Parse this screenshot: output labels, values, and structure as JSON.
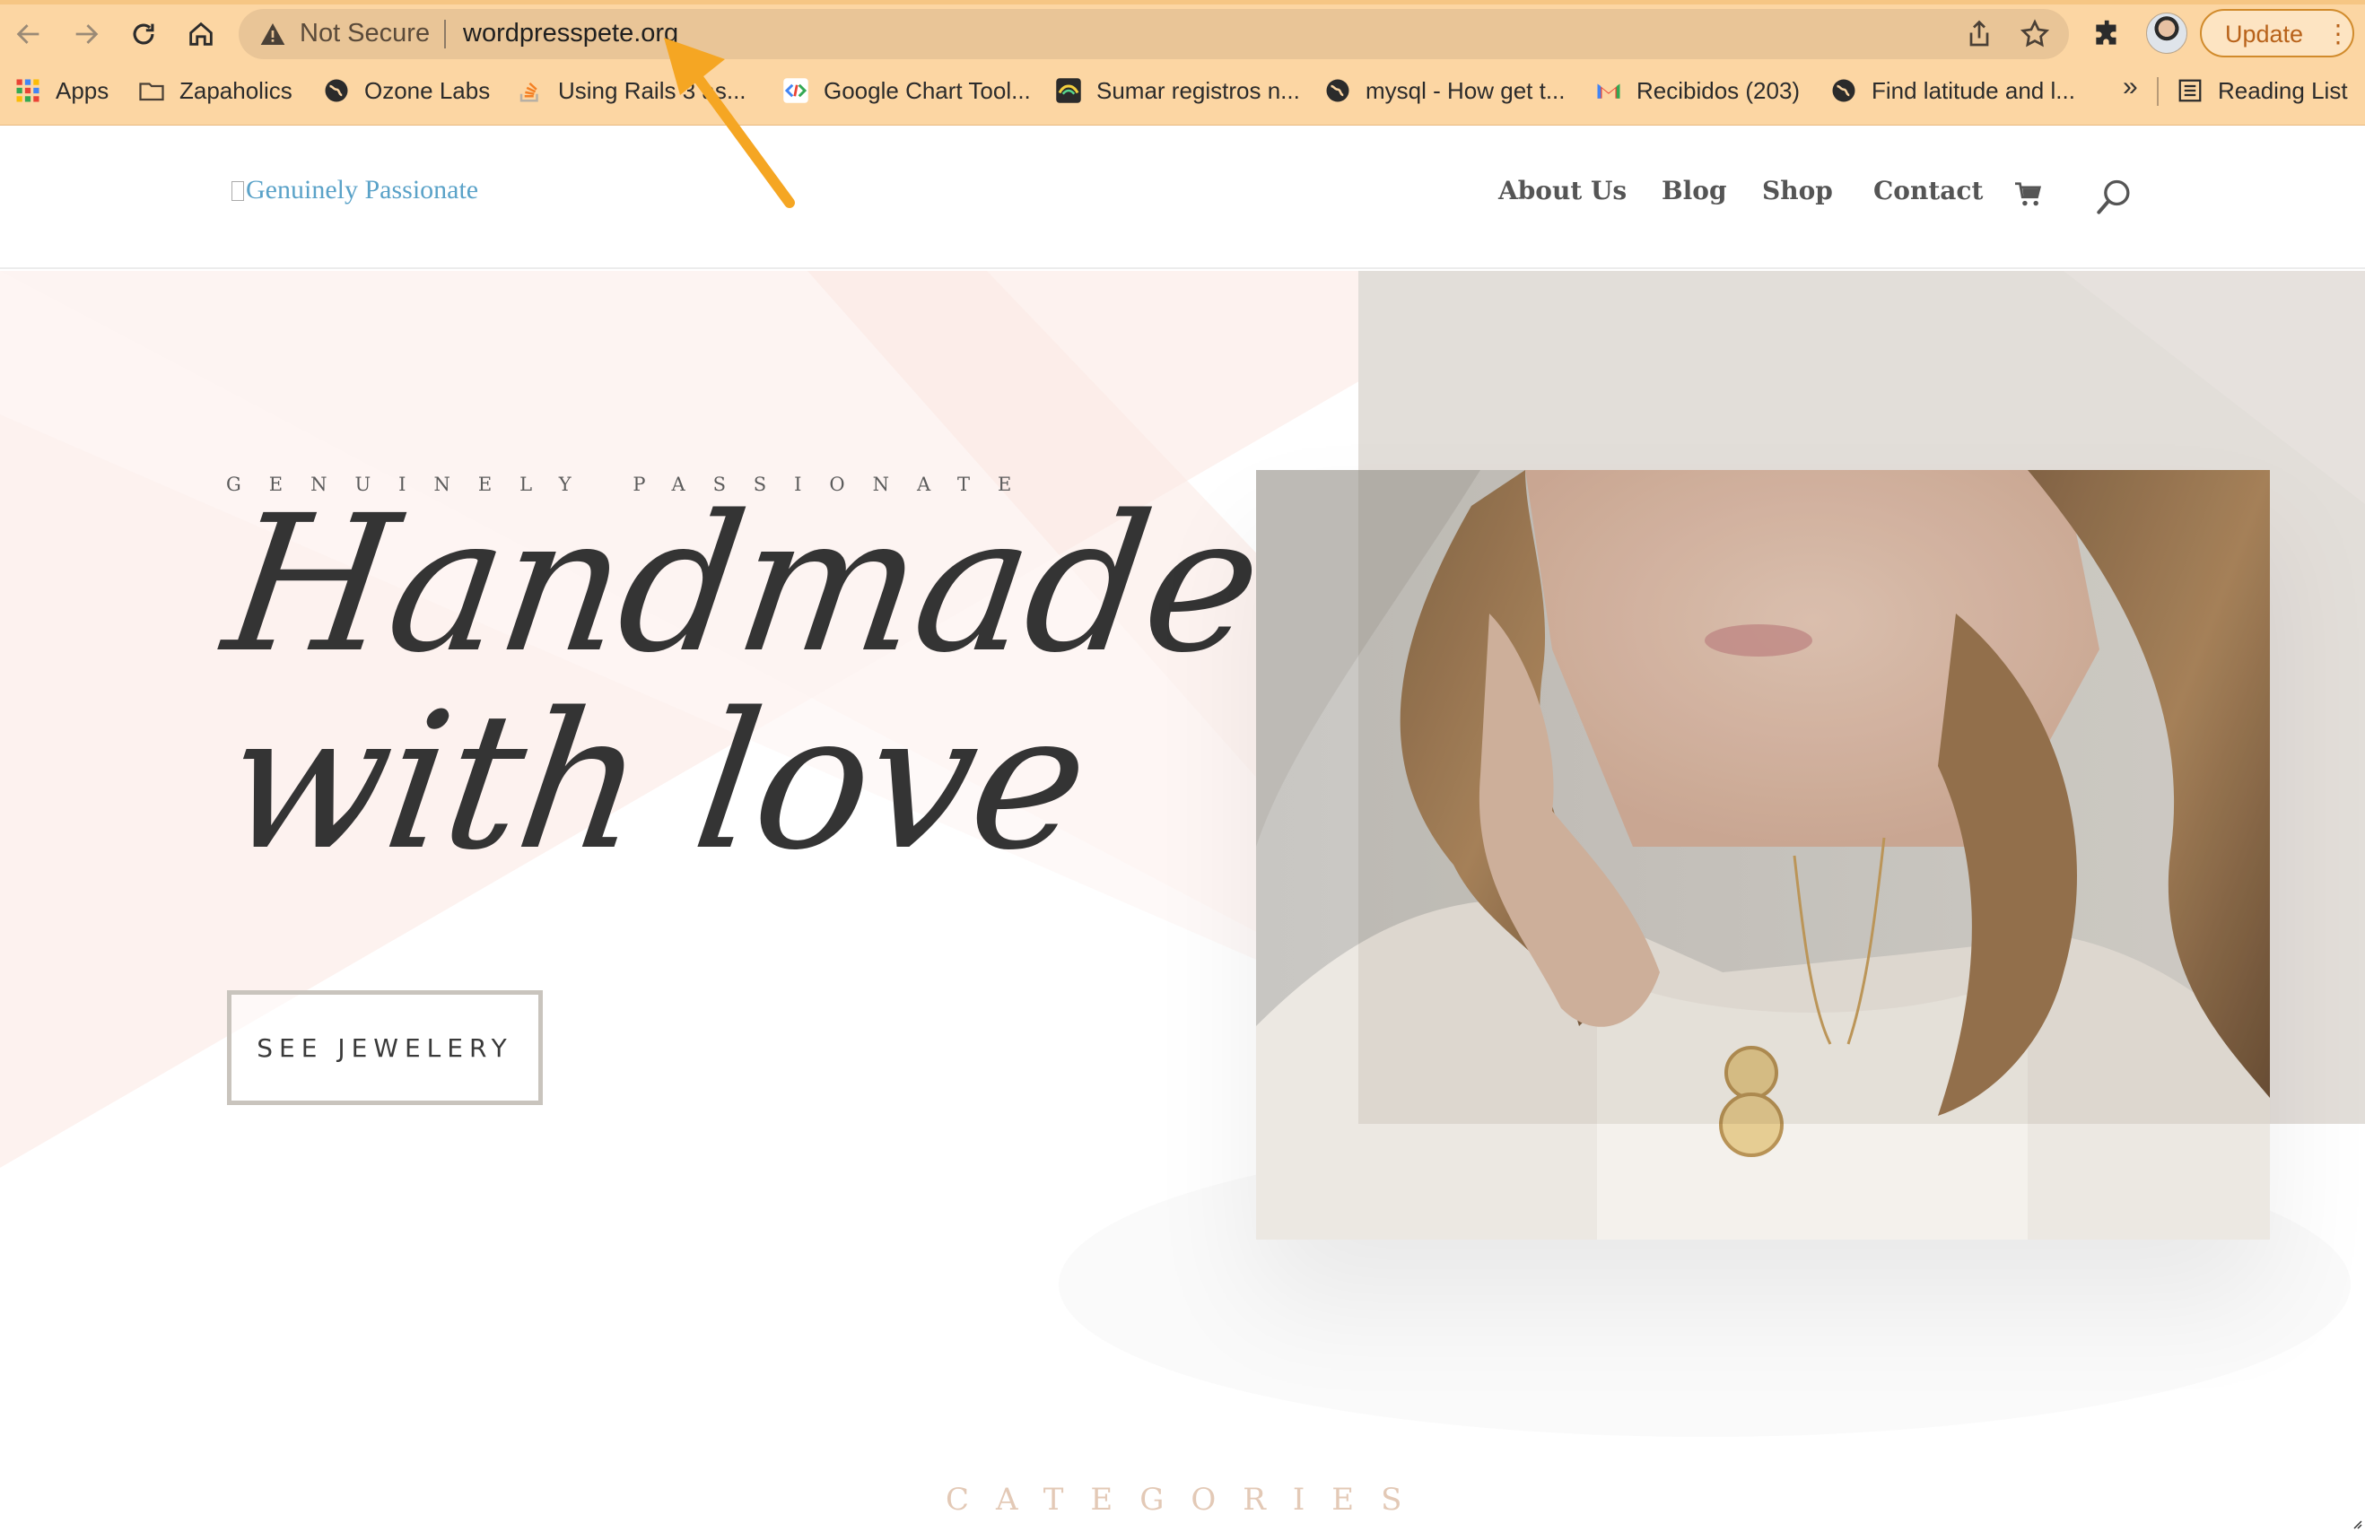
{
  "browser": {
    "security_label": "Not Secure",
    "url": "wordpresspete.org",
    "update_label": "Update",
    "bookmarks": [
      {
        "label": "Apps",
        "icon": "apps-grid-icon"
      },
      {
        "label": "Zapaholics",
        "icon": "folder-icon"
      },
      {
        "label": "Ozone Labs",
        "icon": "globe-icon"
      },
      {
        "label": "Using Rails 3 as...",
        "icon": "stack-overflow-icon"
      },
      {
        "label": "Google Chart Tool...",
        "icon": "google-chart-icon"
      },
      {
        "label": "Sumar registros n...",
        "icon": "site-icon"
      },
      {
        "label": "mysql - How get t...",
        "icon": "globe-icon"
      },
      {
        "label": "Recibidos (203)",
        "icon": "gmail-icon"
      },
      {
        "label": "Find latitude and l...",
        "icon": "globe-icon"
      }
    ],
    "more_bookmarks": "»",
    "reading_list_label": "Reading List"
  },
  "site": {
    "logo_alt": "Genuinely Passionate",
    "menu": [
      "About Us",
      "Blog",
      "Shop",
      "Contact"
    ],
    "cart_icon": "cart-icon",
    "search_icon": "search-icon"
  },
  "hero": {
    "eyebrow": "GENUINELY PASSIONATE",
    "headline_line1": "Handmade",
    "headline_line2": "with love",
    "cta_label": "SEE JEWELERY"
  },
  "next_section": {
    "title": "CATEGORIES"
  },
  "colors": {
    "chrome_bg": "#fcd6a3",
    "omnibox_bg": "#e9c597",
    "update_accent": "#d18b2c",
    "annotation_arrow": "#f5a623",
    "hero_pink": "#fdf1ee",
    "headline": "#343434"
  }
}
